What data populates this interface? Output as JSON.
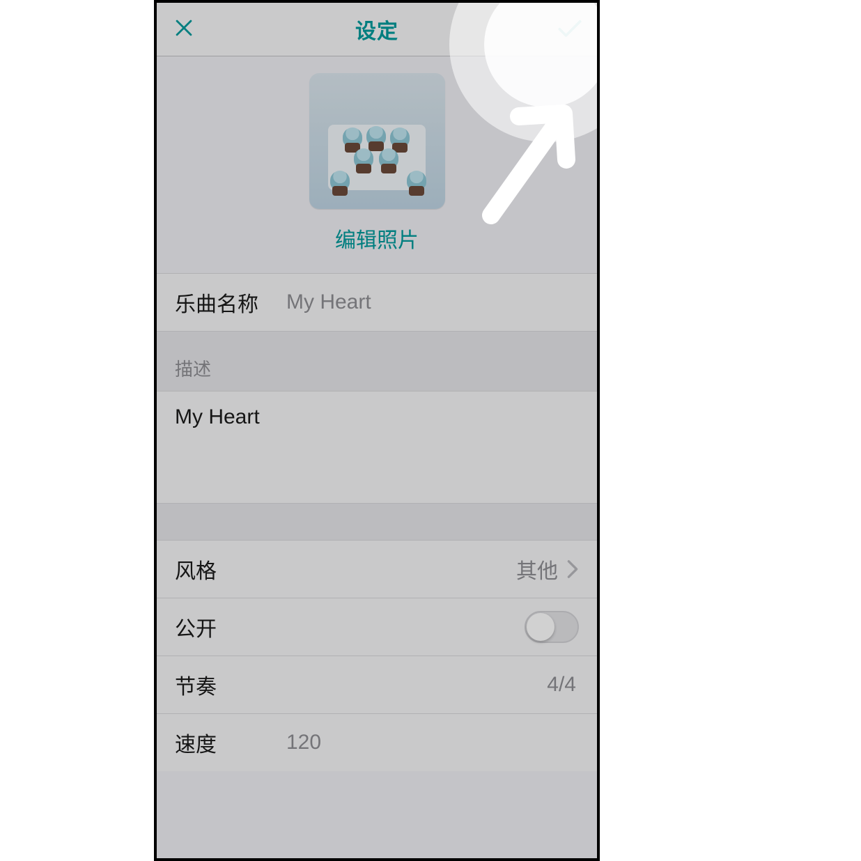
{
  "header": {
    "title": "设定"
  },
  "photo": {
    "edit_label": "编辑照片"
  },
  "fields": {
    "song_name": {
      "label": "乐曲名称",
      "value": "My Heart"
    },
    "description": {
      "label": "描述",
      "value": "My Heart"
    },
    "style": {
      "label": "风格",
      "value": "其他"
    },
    "public": {
      "label": "公开",
      "on": false
    },
    "rhythm": {
      "label": "节奏",
      "value": "4/4"
    },
    "tempo": {
      "label": "速度",
      "value": "120"
    }
  },
  "colors": {
    "accent": "#009a9c"
  }
}
